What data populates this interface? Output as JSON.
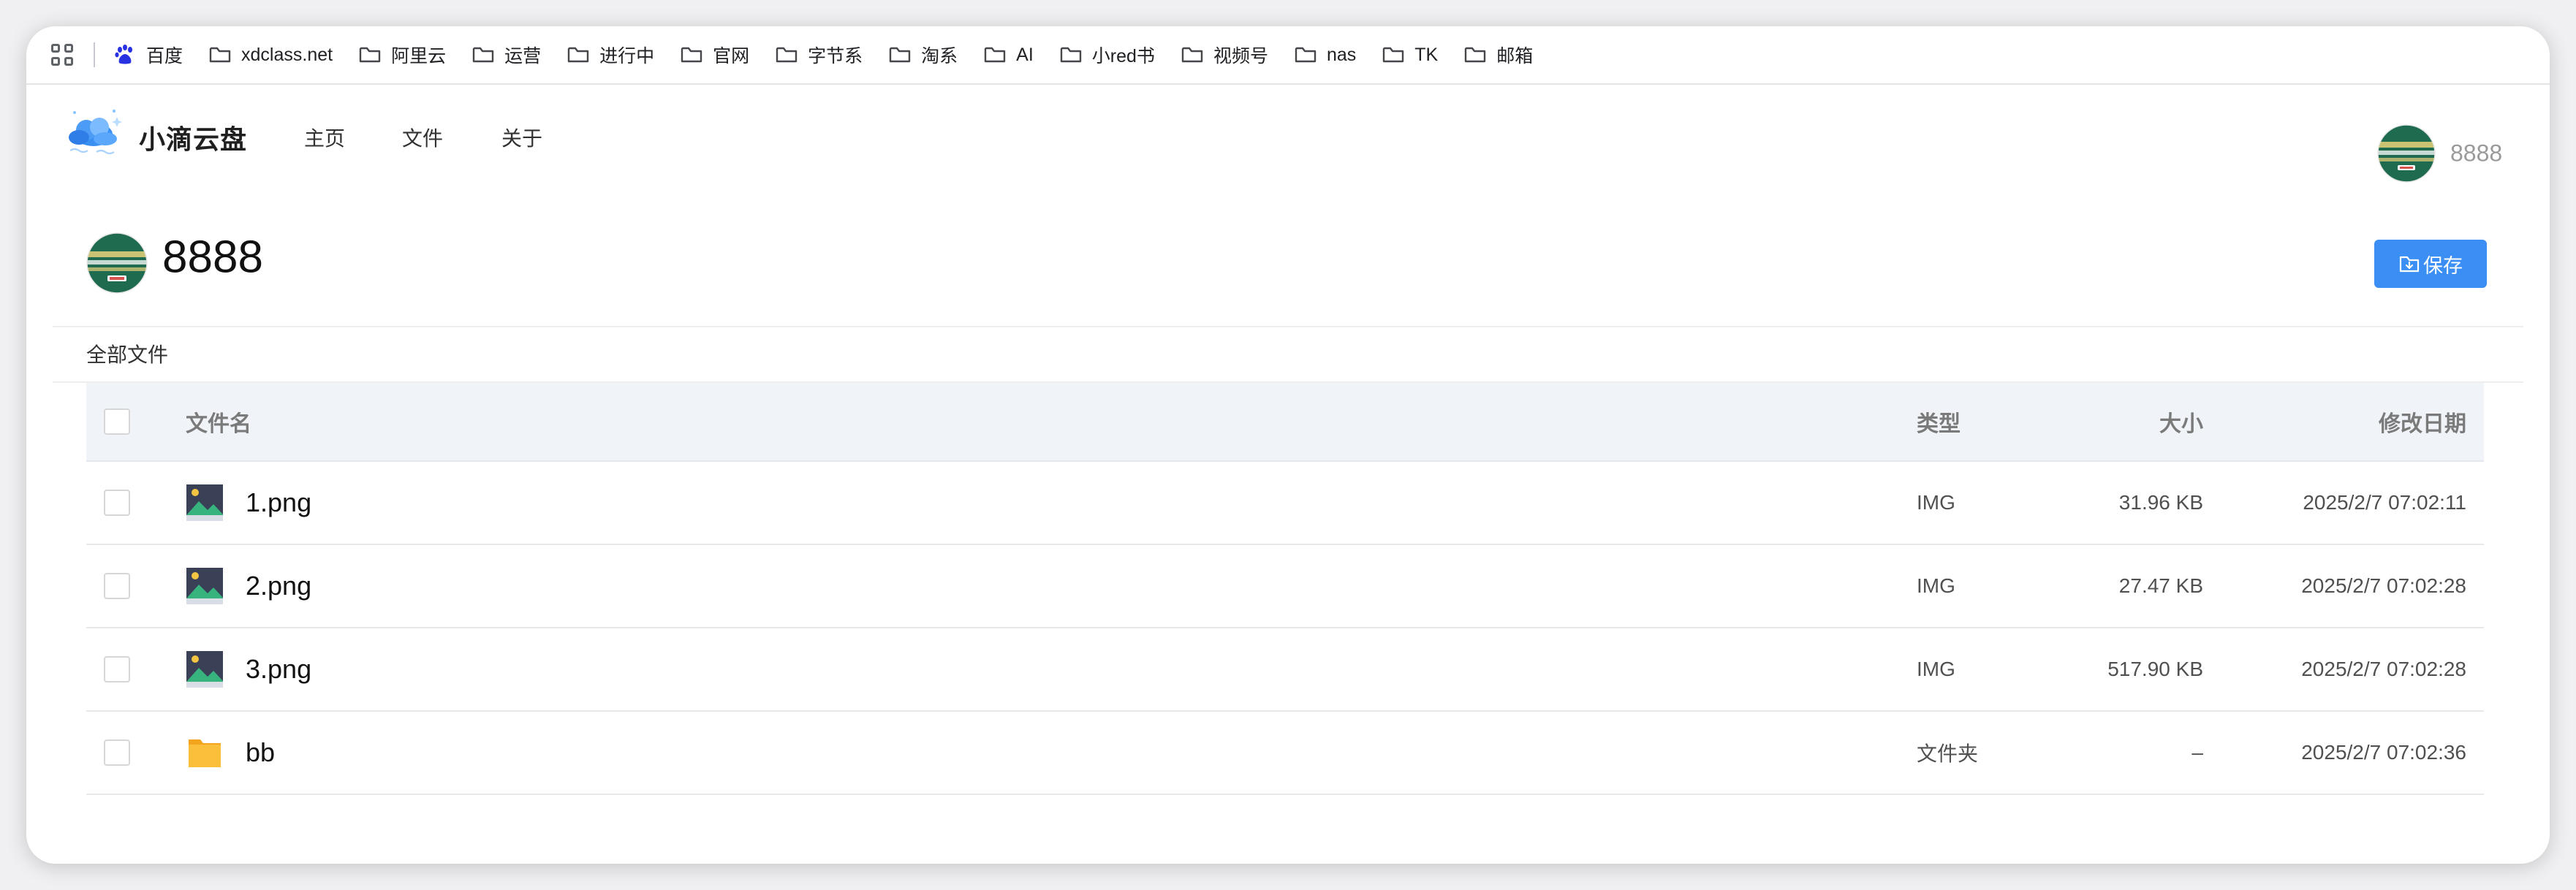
{
  "bookmarks_bar": {
    "items": [
      {
        "label": "百度",
        "icon": "baidu-paw-icon"
      },
      {
        "label": "xdclass.net",
        "icon": "folder-icon"
      },
      {
        "label": "阿里云",
        "icon": "folder-icon"
      },
      {
        "label": "运营",
        "icon": "folder-icon"
      },
      {
        "label": "进行中",
        "icon": "folder-icon"
      },
      {
        "label": "官网",
        "icon": "folder-icon"
      },
      {
        "label": "字节系",
        "icon": "folder-icon"
      },
      {
        "label": "淘系",
        "icon": "folder-icon"
      },
      {
        "label": "AI",
        "icon": "folder-icon"
      },
      {
        "label": "小red书",
        "icon": "folder-icon"
      },
      {
        "label": "视频号",
        "icon": "folder-icon"
      },
      {
        "label": "nas",
        "icon": "folder-icon"
      },
      {
        "label": "TK",
        "icon": "folder-icon"
      },
      {
        "label": "邮箱",
        "icon": "folder-icon"
      }
    ]
  },
  "header": {
    "brand": "小滴云盘",
    "nav": [
      {
        "label": "主页"
      },
      {
        "label": "文件"
      },
      {
        "label": "关于"
      }
    ],
    "username": "8888"
  },
  "share": {
    "owner_name": "8888",
    "save_label": "保存",
    "breadcrumb": "全部文件"
  },
  "table": {
    "columns": {
      "name": "文件名",
      "type": "类型",
      "size": "大小",
      "date": "修改日期"
    },
    "rows": [
      {
        "name": "1.png",
        "type": "IMG",
        "size": "31.96 KB",
        "date": "2025/2/7 07:02:11",
        "icon": "image-file-icon"
      },
      {
        "name": "2.png",
        "type": "IMG",
        "size": "27.47 KB",
        "date": "2025/2/7 07:02:28",
        "icon": "image-file-icon"
      },
      {
        "name": "3.png",
        "type": "IMG",
        "size": "517.90 KB",
        "date": "2025/2/7 07:02:28",
        "icon": "image-file-icon"
      },
      {
        "name": "bb",
        "type": "文件夹",
        "size": "–",
        "date": "2025/2/7 07:02:36",
        "icon": "folder-icon"
      }
    ]
  },
  "colors": {
    "primary": "#3b8ef3",
    "table_header_bg": "#f0f4f9",
    "folder": "#fbbf3c",
    "avatar_green": "#1f6b4f"
  }
}
